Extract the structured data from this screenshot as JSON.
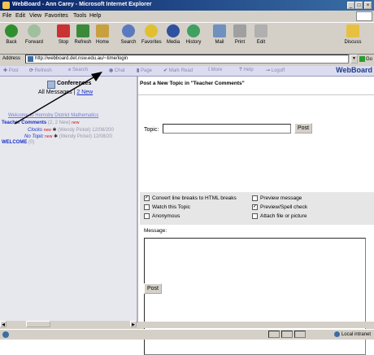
{
  "window": {
    "title": "WebBoard - Ann Carey - Microsoft Internet Explorer",
    "buttons": [
      "_",
      "□",
      "×"
    ]
  },
  "menu": [
    "File",
    "Edit",
    "View",
    "Favorites",
    "Tools",
    "Help"
  ],
  "toolbar": [
    {
      "label": "Back",
      "icon": "back-arrow-icon",
      "color": "#2f8f2f"
    },
    {
      "label": "Forward",
      "icon": "forward-arrow-icon",
      "color": "#9fbf9f"
    },
    {
      "label": "Stop",
      "icon": "stop-icon",
      "color": "#c83232"
    },
    {
      "label": "Refresh",
      "icon": "refresh-icon",
      "color": "#3a8a3a"
    },
    {
      "label": "Home",
      "icon": "home-icon",
      "color": "#c8a040"
    },
    {
      "label": "Search",
      "icon": "search-icon",
      "color": "#5a7ac0"
    },
    {
      "label": "Favorites",
      "icon": "star-icon",
      "color": "#e0c030"
    },
    {
      "label": "Media",
      "icon": "media-icon",
      "color": "#3050a0"
    },
    {
      "label": "History",
      "icon": "history-icon",
      "color": "#40a060"
    },
    {
      "label": "Mail",
      "icon": "mail-icon",
      "color": "#7090c0"
    },
    {
      "label": "Print",
      "icon": "print-icon",
      "color": "#a0a0a0"
    },
    {
      "label": "Edit",
      "icon": "edit-icon",
      "color": "#b0b0b0"
    },
    {
      "label": "Discuss",
      "icon": "discuss-icon",
      "color": "#e8c040"
    }
  ],
  "address": {
    "label": "Address",
    "url": "http://webboard.det.nsw.edu.au/~time/login",
    "go": "Go"
  },
  "webboard_nav": {
    "items": [
      "Post",
      "Refresh",
      "Search",
      "Chat",
      "Page",
      "Mark Read",
      "More",
      "Help",
      "Logoff"
    ],
    "brand": "WebBoard"
  },
  "sidebar": {
    "title": "Conferences",
    "all_messages": "All Messages",
    "new_count": "2 New",
    "welcome_link": "Welcome to Hornsby District Mathematics",
    "tree": {
      "conference": "Teacher Comments",
      "conference_counts": "(2, 2 New)",
      "new_badge": "new",
      "topics": [
        {
          "title": "Clocks",
          "author": "(Wendy Pickel) 12/08/200"
        },
        {
          "title": "No Topic",
          "author": "(Wendy Pickel) 12/08/20"
        }
      ],
      "welcome": "WELCOME",
      "welcome_count": "(0)"
    }
  },
  "form": {
    "header": "Post a New Topic in \"Teacher Comments\"",
    "topic_label": "Topic:",
    "post_button": "Post",
    "options": [
      {
        "label": "Convert line breaks to HTML breaks",
        "checked": true
      },
      {
        "label": "Preview message",
        "checked": false
      },
      {
        "label": "Watch this Topic",
        "checked": false
      },
      {
        "label": "Preview/Spell check",
        "checked": true
      },
      {
        "label": "Anonymous",
        "checked": false
      },
      {
        "label": "Attach file or picture",
        "checked": false
      }
    ],
    "message_label": "Message:"
  },
  "status": {
    "zone": "Local intranet"
  }
}
